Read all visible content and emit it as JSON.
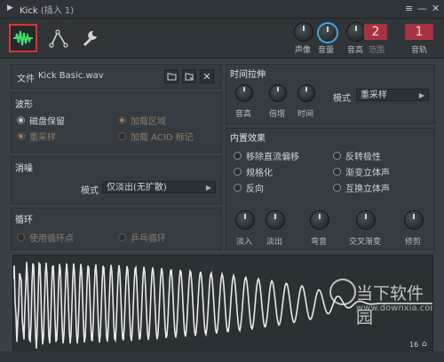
{
  "window": {
    "title": "Kick",
    "title_suffix": "(插入 1)"
  },
  "toolbar": {
    "knobs": [
      {
        "label": "声像"
      },
      {
        "label": "音量"
      },
      {
        "label": "音高"
      },
      {
        "label": "范围"
      }
    ],
    "pitch_range_value": "2",
    "track_value": "1",
    "track_label": "音轨"
  },
  "file": {
    "label": "文件",
    "filename": "Kick Basic.wav"
  },
  "waveform": {
    "title": "波形",
    "options": [
      {
        "label": "磁盘保留",
        "checked": true,
        "dim": false
      },
      {
        "label": "加载区域",
        "checked": true,
        "dim": true
      },
      {
        "label": "重采样",
        "checked": true,
        "dim": true
      },
      {
        "label": "加载 ACID 标记",
        "checked": false,
        "dim": true
      }
    ]
  },
  "denoise": {
    "title": "消噪",
    "mode_label": "模式",
    "mode_value": "仅淡出(无扩散)"
  },
  "loop": {
    "title": "循环",
    "options": [
      {
        "label": "使用循环点",
        "checked": false
      },
      {
        "label": "乒乓循环",
        "checked": false
      }
    ]
  },
  "time_stretch": {
    "title": "时间拉伸",
    "knobs": [
      {
        "label": "音高"
      },
      {
        "label": "倍增"
      },
      {
        "label": "时间"
      }
    ],
    "mode_label": "模式",
    "mode_value": "重采样"
  },
  "effects": {
    "title": "内置效果",
    "options": [
      {
        "label": "移除直流偏移",
        "checked": false
      },
      {
        "label": "反转极性",
        "checked": false
      },
      {
        "label": "规格化",
        "checked": false
      },
      {
        "label": "渐变立体声",
        "checked": false
      },
      {
        "label": "反向",
        "checked": false
      },
      {
        "label": "互换立体声",
        "checked": false
      }
    ],
    "knobs": [
      {
        "label": "淡入"
      },
      {
        "label": "淡出"
      },
      {
        "label": "弯音"
      },
      {
        "label": "交叉渐变"
      },
      {
        "label": "修剪"
      }
    ]
  },
  "wave_display": {
    "zoom_value": "16"
  },
  "watermark": {
    "brand": "当下软件园",
    "url": "www.downxia.com"
  }
}
